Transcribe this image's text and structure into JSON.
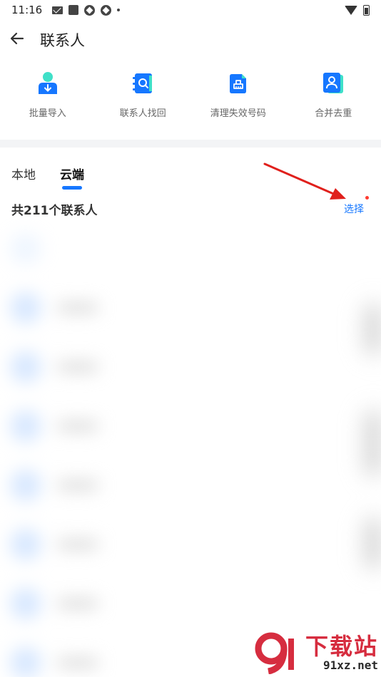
{
  "status_bar": {
    "time": "11:16",
    "icons": [
      "mail-icon",
      "square-icon",
      "aperture-icon",
      "aperture-icon",
      "dot-icon"
    ],
    "right_icons": [
      "wifi-icon",
      "battery-icon"
    ]
  },
  "header": {
    "title": "联系人",
    "back_icon": "arrow-left-icon"
  },
  "tools": [
    {
      "label": "批量导入",
      "icon": "person-download-icon"
    },
    {
      "label": "联系人找回",
      "icon": "contact-book-search-icon"
    },
    {
      "label": "清理失效号码",
      "icon": "broom-clean-icon"
    },
    {
      "label": "合并去重",
      "icon": "merge-contact-icon"
    }
  ],
  "tabs": [
    {
      "label": "本地",
      "active": false
    },
    {
      "label": "云端",
      "active": true
    }
  ],
  "contacts": {
    "count_label": "共211个联系人",
    "select_label": "选择"
  },
  "colors": {
    "accent": "#1677ff",
    "badge": "#ff3b30",
    "arrow": "#e0201c",
    "watermark_red": "#d62d3f"
  },
  "watermark": {
    "cn": "下载站",
    "en": "91xz.net"
  }
}
